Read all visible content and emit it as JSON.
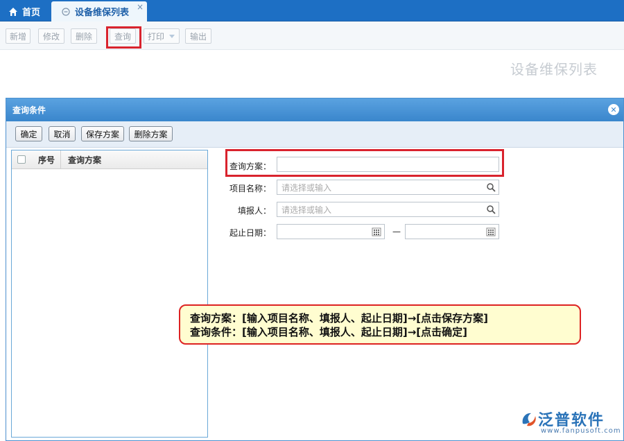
{
  "tabs": {
    "home": "首页",
    "active": "设备维保列表",
    "close": "×"
  },
  "toolbar": {
    "add": "新增",
    "edit": "修改",
    "delete": "删除",
    "query": "查询",
    "print": "打印",
    "export": "输出"
  },
  "page": {
    "heading": "设备维保列表"
  },
  "dialog": {
    "title": "查询条件",
    "buttons": {
      "confirm": "确定",
      "cancel": "取消",
      "save_scheme": "保存方案",
      "delete_scheme": "删除方案"
    },
    "list_columns": {
      "seq": "序号",
      "scheme": "查询方案"
    },
    "form": {
      "scheme_label": "查询方案：",
      "project_label": "项目名称：",
      "project_placeholder": "请选择或输入",
      "reporter_label": "填报人：",
      "reporter_placeholder": "请选择或输入",
      "date_label": "起止日期：",
      "date_sep": "—"
    }
  },
  "callout": {
    "line1": "查询方案：[输入项目名称、填报人、起止日期]→[点击保存方案]",
    "line2": "查询条件：[输入项目名称、填报人、起止日期]→[点击确定]"
  },
  "watermark": {
    "name": "泛普软件",
    "url": "www.fanpusoft.com"
  },
  "colors": {
    "tabbar": "#1d6fc4",
    "dialog_header": "#3a86cc",
    "highlight": "#d9232d",
    "callout_bg": "#fffdd0"
  }
}
